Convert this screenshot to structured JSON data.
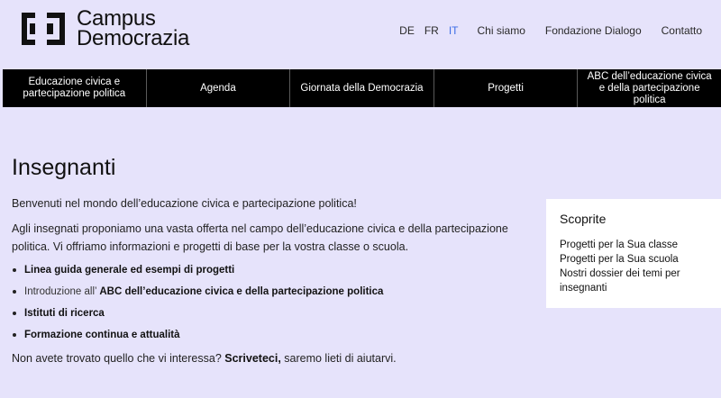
{
  "brand": {
    "line1": "Campus",
    "line2": "Democrazia"
  },
  "languages": [
    {
      "code": "DE",
      "active": false
    },
    {
      "code": "FR",
      "active": false
    },
    {
      "code": "IT",
      "active": true
    }
  ],
  "top_links": [
    "Chi siamo",
    "Fondazione Dialogo",
    "Contatto"
  ],
  "main_nav": [
    "Educazione civica e partecipazione politica",
    "Agenda",
    "Giornata della Democrazia",
    "Progetti",
    "ABC dell’educazione civica e della partecipazione politica"
  ],
  "main": {
    "title": "Insegnanti",
    "intro": "Benvenuti nel mondo dell’educazione civica e partecipazione politica!",
    "description": "Agli insegnati proponiamo una vasta offerta nel campo dell’educazione civica e della partecipazione politica. Vi offriamo informazioni e progetti di base per la vostra classe o scuola.",
    "links": [
      {
        "prefix": "",
        "text": "Linea guida generale ed esempi di progetti"
      },
      {
        "prefix": "Introduzione all’ ",
        "text": "ABC dell’educazione civica e della partecipazione politica"
      },
      {
        "prefix": "",
        "text": "Istituti di ricerca"
      },
      {
        "prefix": "",
        "text": "Formazione continua e attualità"
      }
    ],
    "closing_before": "Non avete trovato quello che vi interessa? ",
    "closing_link": "Scriveteci,",
    "closing_after": " saremo lieti di aiutarvi."
  },
  "sidebar": {
    "title": "Scoprite",
    "links": [
      "Progetti per la Sua classe",
      "Progetti per la Sua scuola",
      "Nostri dossier dei temi per insegnanti"
    ]
  },
  "colors": {
    "background": "#e6e3fb",
    "nav_bg": "#000000",
    "active_lang": "#3d6ee6"
  },
  "icons": {
    "logo": "campus-democrazia-logo-mark"
  }
}
